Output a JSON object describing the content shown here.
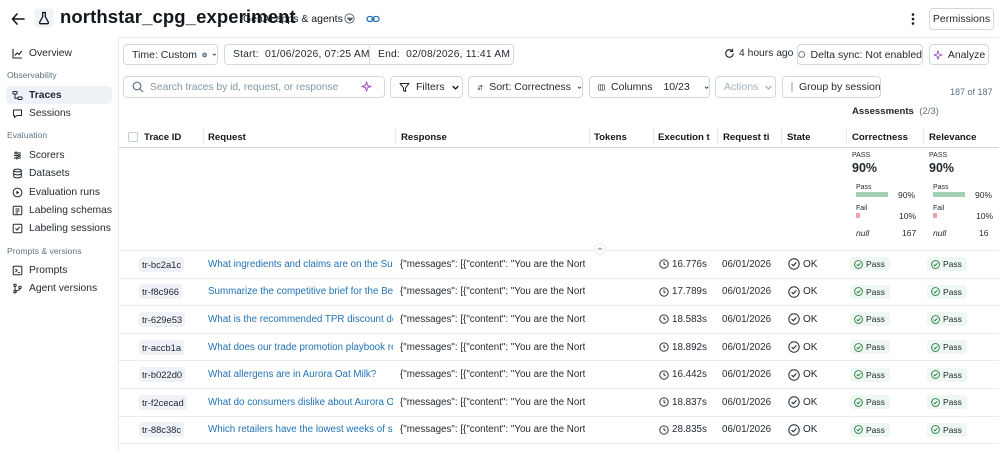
{
  "header": {
    "title": "northstar_cpg_experiment",
    "tag": "GenAI apps & agents",
    "permissions_label": "Permissions"
  },
  "sidebar": {
    "overview": "Overview",
    "sections": {
      "observability": "Observability",
      "evaluation": "Evaluation",
      "prompts_versions": "Prompts & versions"
    },
    "items": {
      "traces": "Traces",
      "sessions": "Sessions",
      "scorers": "Scorers",
      "datasets": "Datasets",
      "evaluation_runs": "Evaluation runs",
      "labeling_schemas": "Labeling schemas",
      "labeling_sessions": "Labeling sessions",
      "prompts": "Prompts",
      "agent_versions": "Agent versions"
    }
  },
  "toolbar": {
    "time_label": "Time: Custom",
    "start_label": "Start:",
    "start_value": "01/06/2026, 07:25 AM",
    "end_label": "End:",
    "end_value": "02/08/2026, 11:41 AM",
    "refreshed": "4 hours ago",
    "delta_sync": "Delta sync: Not enabled",
    "analyze": "Analyze",
    "search_placeholder": "Search traces by id, request, or response",
    "filters": "Filters",
    "sort": "Sort: Correctness",
    "columns_label": "Columns",
    "columns_value": "10/23",
    "actions": "Actions",
    "group_by_session": "Group by session",
    "count": "187 of 187"
  },
  "assessments": {
    "title": "Assessments",
    "count": "(2/3)"
  },
  "table": {
    "headers": {
      "trace_id": "Trace ID",
      "request": "Request",
      "response": "Response",
      "tokens": "Tokens",
      "execution_time": "Execution t",
      "request_time": "Request ti",
      "state": "State",
      "correctness": "Correctness",
      "relevance": "Relevance"
    },
    "aggregates": {
      "correctness": {
        "label": "PASS",
        "big": "90%",
        "pass_label": "Pass",
        "pass_pct": "90%",
        "pass_fraction": 0.9,
        "fail_label": "Fail",
        "fail_pct": "10%",
        "fail_fraction": 0.1,
        "null_label": "null",
        "null_count": "167"
      },
      "relevance": {
        "label": "PASS",
        "big": "90%",
        "pass_label": "Pass",
        "pass_pct": "90%",
        "pass_fraction": 0.9,
        "fail_label": "Fail",
        "fail_pct": "10%",
        "fail_fraction": 0.1,
        "null_label": "null",
        "null_count": "16"
      }
    },
    "rows": [
      {
        "trace_id": "tr-bc2a1c",
        "request": "What ingredients and claims are on the Sum",
        "response": "{\"messages\": [{\"content\": \"You are the North",
        "exec": "16.776s",
        "req_time": "06/01/2026",
        "state": "OK",
        "correctness": "Pass",
        "relevance": "Pass"
      },
      {
        "trace_id": "tr-f8c966",
        "request": "Summarize the competitive brief for the Bev",
        "response": "{\"messages\": [{\"content\": \"You are the North",
        "exec": "17.789s",
        "req_time": "06/01/2026",
        "state": "OK",
        "correctness": "Pass",
        "relevance": "Pass"
      },
      {
        "trace_id": "tr-629e53",
        "request": "What is the recommended TPR discount de",
        "response": "{\"messages\": [{\"content\": \"You are the North",
        "exec": "18.583s",
        "req_time": "06/01/2026",
        "state": "OK",
        "correctness": "Pass",
        "relevance": "Pass"
      },
      {
        "trace_id": "tr-accb1a",
        "request": "What does our trade promotion playbook re",
        "response": "{\"messages\": [{\"content\": \"You are the North",
        "exec": "18.892s",
        "req_time": "06/01/2026",
        "state": "OK",
        "correctness": "Pass",
        "relevance": "Pass"
      },
      {
        "trace_id": "tr-b022d0",
        "request": "What allergens are in Aurora Oat Milk?",
        "response": "{\"messages\": [{\"content\": \"You are the North",
        "exec": "16.442s",
        "req_time": "06/01/2026",
        "state": "OK",
        "correctness": "Pass",
        "relevance": "Pass"
      },
      {
        "trace_id": "tr-f2cecad",
        "request": "What do consumers dislike about Aurora Oa",
        "response": "{\"messages\": [{\"content\": \"You are the North",
        "exec": "18.837s",
        "req_time": "06/01/2026",
        "state": "OK",
        "correctness": "Pass",
        "relevance": "Pass"
      },
      {
        "trace_id": "tr-88c38c",
        "request": "Which retailers have the lowest weeks of su",
        "response": "{\"messages\": [{\"content\": \"You are the North",
        "exec": "28.835s",
        "req_time": "06/01/2026",
        "state": "OK",
        "correctness": "Pass",
        "relevance": "Pass"
      }
    ]
  }
}
